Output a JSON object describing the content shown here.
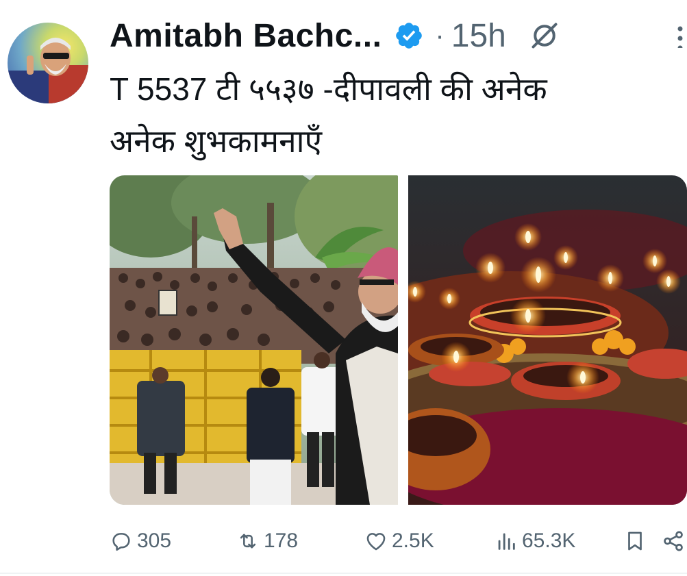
{
  "author": {
    "display_name": "Amitabh Bachc...",
    "verified": true,
    "time_ago": "15h",
    "separator": "·"
  },
  "tweet": {
    "text_line1": "T 5537 टी ५५३७ -दीपावली की अनेक",
    "text_line2": "अनेक शुभकामनाएँ"
  },
  "media": [
    {
      "icon": "photo-crowd-waving"
    },
    {
      "icon": "photo-diya-lamps"
    }
  ],
  "actions": {
    "replies": "305",
    "reposts": "178",
    "likes": "2.5K",
    "views": "65.3K"
  },
  "colors": {
    "text": "#0f1419",
    "secondary": "#536471",
    "verified_blue": "#1d9bf0"
  }
}
